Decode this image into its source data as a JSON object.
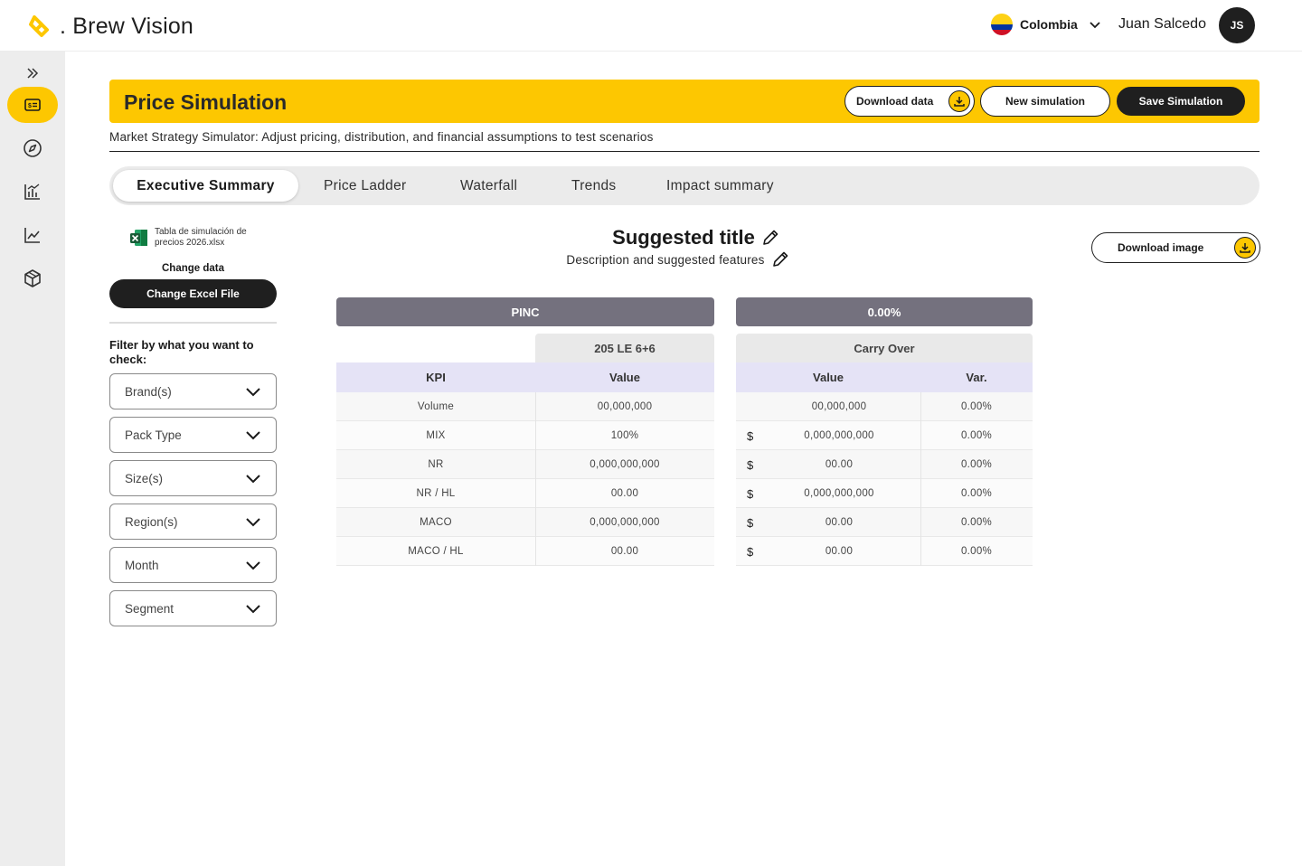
{
  "app": {
    "name": ". Brew Vision"
  },
  "topbar": {
    "country": "Colombia",
    "user_name": "Juan Salcedo",
    "user_initials": "JS"
  },
  "sidebar": {
    "items": [
      {
        "icon": "chevrons-right-icon"
      },
      {
        "icon": "price-tag-card-icon",
        "active": true
      },
      {
        "icon": "compass-icon"
      },
      {
        "icon": "bar-chart-icon"
      },
      {
        "icon": "line-chart-icon"
      },
      {
        "icon": "cube-icon"
      }
    ]
  },
  "header": {
    "title": "Price Simulation",
    "download_data": "Download data",
    "new_simulation": "New simulation",
    "save_simulation": "Save Simulation",
    "subtitle": "Market Strategy Simulator: Adjust pricing, distribution, and financial assumptions to test scenarios"
  },
  "tabs": [
    "Executive Summary",
    "Price Ladder",
    "Waterfall",
    "Trends",
    "Impact summary"
  ],
  "left_panel": {
    "file_name": "Tabla de simulación de precios 2026.xlsx",
    "change_data": "Change data",
    "change_excel": "Change Excel File",
    "filter_title": "Filter by what you want to check:",
    "filters": [
      "Brand(s)",
      "Pack Type",
      "Size(s)",
      "Region(s)",
      "Month",
      "Segment"
    ]
  },
  "content": {
    "title": "Suggested title",
    "description": "Description and suggested features",
    "download_image": "Download image"
  },
  "table": {
    "left_header": "PINC",
    "right_header": "0.00%",
    "left_subheader": "205 LE 6+6",
    "right_subheader": "Carry Over",
    "col_kpi": "KPI",
    "col_value": "Value",
    "col_value2": "Value",
    "col_var": "Var.",
    "currency": "$",
    "rows": [
      {
        "kpi": "Volume",
        "value": "00,000,000",
        "co_value": "00,000,000",
        "var": "0.00%",
        "dollar": ""
      },
      {
        "kpi": "MIX",
        "value": "100%",
        "co_value": "0,000,000,000",
        "var": "0.00%",
        "dollar": "$"
      },
      {
        "kpi": "NR",
        "value": "0,000,000,000",
        "co_value": "00.00",
        "var": "0.00%",
        "dollar": "$"
      },
      {
        "kpi": "NR / HL",
        "value": "00.00",
        "co_value": "0,000,000,000",
        "var": "0.00%",
        "dollar": "$"
      },
      {
        "kpi": "MACO",
        "value": "0,000,000,000",
        "co_value": "00.00",
        "var": "0.00%",
        "dollar": "$"
      },
      {
        "kpi": "MACO / HL",
        "value": "00.00",
        "co_value": "00.00",
        "var": "0.00%",
        "dollar": "$"
      }
    ]
  }
}
